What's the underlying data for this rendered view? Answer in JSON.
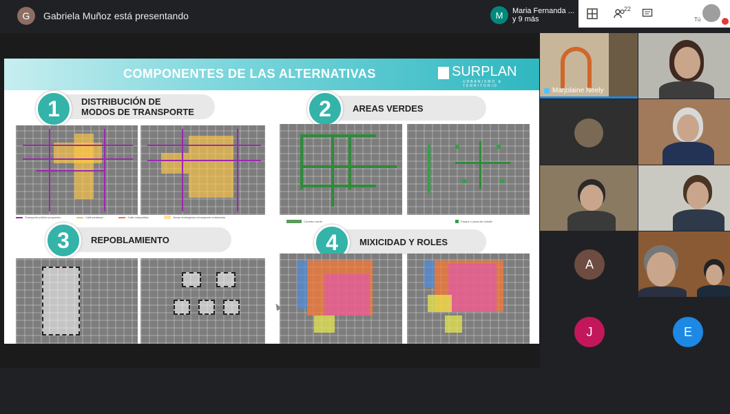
{
  "presenter": {
    "avatar_letter": "G",
    "text": "Gabriela Muñoz está presentando"
  },
  "participants_badge": {
    "letter": "M",
    "line1": "Maria Fernanda ...",
    "line2": "y 9 más"
  },
  "toolbar": {
    "layout_icon": "layout-icon",
    "people_icon": "people-icon",
    "people_count": "22",
    "chat_icon": "chat-icon",
    "self_label": "Tú"
  },
  "slide": {
    "title": "COMPONENTES DE LAS ALTERNATIVAS",
    "logo": "SURPLAN",
    "logo_sub": "URBANISMO & TERRITORIO",
    "sections": [
      {
        "number": "1",
        "label_line1": "DISTRIBUCIÓN DE",
        "label_line2": "MODOS DE TRANSPORTE"
      },
      {
        "number": "2",
        "label_line1": "AREAS VERDES",
        "label_line2": ""
      },
      {
        "number": "3",
        "label_line1": "REPOBLAMIENTO",
        "label_line2": ""
      },
      {
        "number": "4",
        "label_line1": "MIXICIDAD Y ROLES",
        "label_line2": ""
      }
    ],
    "legend1": [
      "Transporte público propuesto",
      "Calle peatonal",
      "Calle compartida",
      "Áreas restringidas a transporte motorizado"
    ],
    "legend2": [
      "Corredor verde",
      "Parque o plaza de bolsillo"
    ],
    "colors": {
      "teal": "#34b3a9",
      "purple": "#9c27b0",
      "green": "#2e8b3a",
      "yellow": "#ffc846"
    }
  },
  "participants": [
    {
      "name": "Marjolaine Neely",
      "speaking": true
    },
    {
      "name": "",
      "speaking": false
    },
    {
      "name": "",
      "speaking": false
    },
    {
      "name": "",
      "speaking": false
    },
    {
      "name": "",
      "speaking": false
    },
    {
      "name": "",
      "speaking": false
    },
    {
      "letter": "A",
      "color": "#6d4c41"
    },
    {
      "name": "",
      "speaking": false
    },
    {
      "letter": "J",
      "color": "#c2185b"
    },
    {
      "letter": "E",
      "color": "#1e88e5"
    }
  ]
}
